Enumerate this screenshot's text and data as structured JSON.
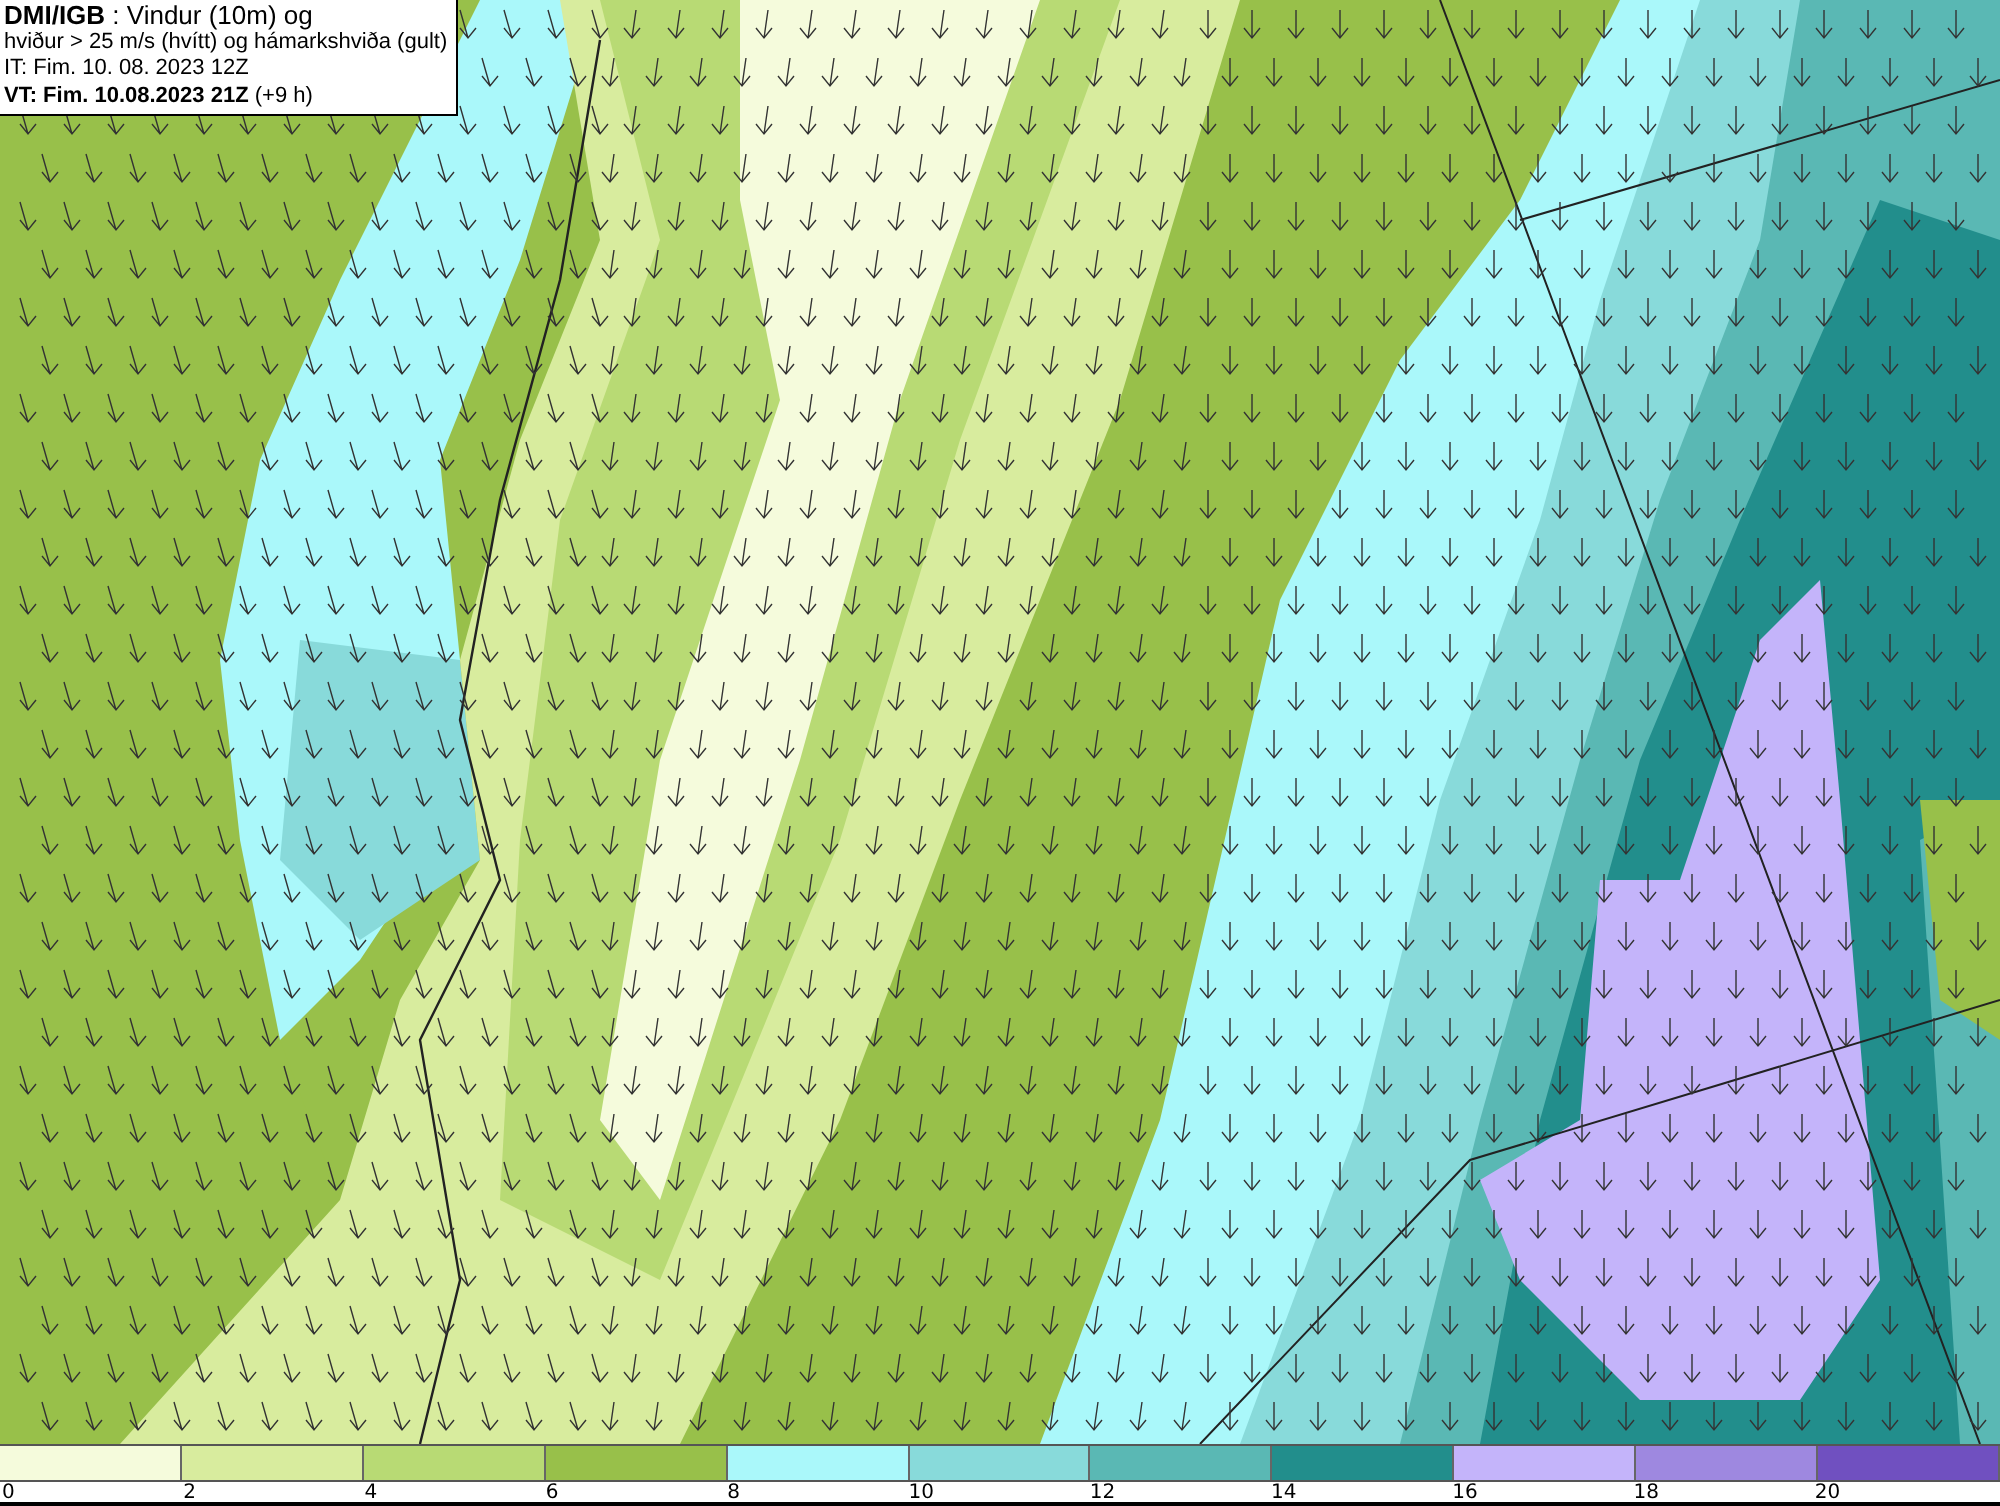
{
  "legend": {
    "lines": [
      "**DMI/IGB** : Vindur (10m) og",
      "hviður > 25 m/s (hvítt) og hámarkshviða (gult)",
      "IT: Fim. 10. 08. 2023 12Z",
      "**VT: Fim. 10.08.2023 21Z** (+9 h)"
    ]
  },
  "colorbar": {
    "bins": [
      {
        "label": "0",
        "color": "#f5fbdc"
      },
      {
        "label": "2",
        "color": "#d8ec9e"
      },
      {
        "label": "4",
        "color": "#b8da74"
      },
      {
        "label": "6",
        "color": "#98c04a"
      },
      {
        "label": "8",
        "color": "#aaf8fa"
      },
      {
        "label": "10",
        "color": "#88dada"
      },
      {
        "label": "12",
        "color": "#5ab8b4"
      },
      {
        "label": "14",
        "color": "#228e8c"
      },
      {
        "label": "16",
        "color": "#c4b4fa"
      },
      {
        "label": "18",
        "color": "#9e88e0"
      },
      {
        "label": "20",
        "color": "#7050c0"
      }
    ]
  }
}
